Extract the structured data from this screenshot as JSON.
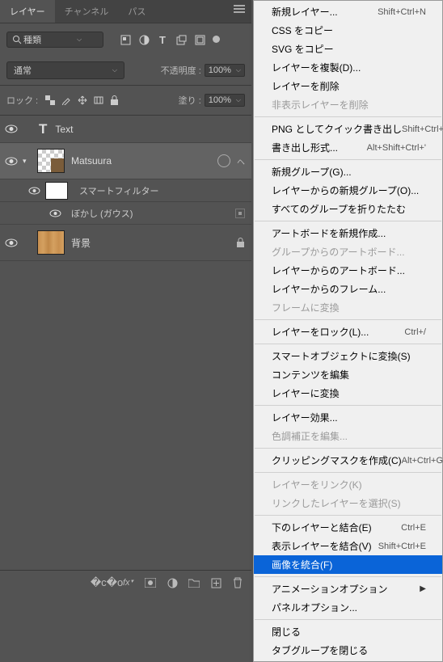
{
  "tabs": [
    "レイヤー",
    "チャンネル",
    "パス"
  ],
  "activeTab": 0,
  "search": {
    "placeholder": "種類"
  },
  "blend": {
    "mode": "通常",
    "opacityLabel": "不透明度 :",
    "opacity": "100%"
  },
  "lock": {
    "label": "ロック :",
    "fillLabel": "塗り :",
    "fill": "100%"
  },
  "layers": [
    {
      "name": "Text",
      "type": "text"
    },
    {
      "name": "Matsuura",
      "type": "smart",
      "selected": true
    },
    {
      "name": "スマートフィルター",
      "type": "sf-head"
    },
    {
      "name": "ぼかし (ガウス)",
      "type": "sf-item"
    },
    {
      "name": "背景",
      "type": "bg"
    }
  ],
  "menu": [
    {
      "t": "item",
      "label": "新規レイヤー...",
      "sc": "Shift+Ctrl+N"
    },
    {
      "t": "item",
      "label": "CSS をコピー"
    },
    {
      "t": "item",
      "label": "SVG をコピー"
    },
    {
      "t": "item",
      "label": "レイヤーを複製(D)..."
    },
    {
      "t": "item",
      "label": "レイヤーを削除"
    },
    {
      "t": "item",
      "label": "非表示レイヤーを削除",
      "dis": true
    },
    {
      "t": "sep"
    },
    {
      "t": "item",
      "label": "PNG としてクイック書き出し",
      "sc": "Shift+Ctrl+'"
    },
    {
      "t": "item",
      "label": "書き出し形式...",
      "sc": "Alt+Shift+Ctrl+'"
    },
    {
      "t": "sep"
    },
    {
      "t": "item",
      "label": "新規グループ(G)..."
    },
    {
      "t": "item",
      "label": "レイヤーからの新規グループ(O)..."
    },
    {
      "t": "item",
      "label": "すべてのグループを折りたたむ"
    },
    {
      "t": "sep"
    },
    {
      "t": "item",
      "label": "アートボードを新規作成..."
    },
    {
      "t": "item",
      "label": "グループからのアートボード...",
      "dis": true
    },
    {
      "t": "item",
      "label": "レイヤーからのアートボード..."
    },
    {
      "t": "item",
      "label": "レイヤーからのフレーム..."
    },
    {
      "t": "item",
      "label": "フレームに変換",
      "dis": true
    },
    {
      "t": "sep"
    },
    {
      "t": "item",
      "label": "レイヤーをロック(L)...",
      "sc": "Ctrl+/"
    },
    {
      "t": "sep"
    },
    {
      "t": "item",
      "label": "スマートオブジェクトに変換(S)"
    },
    {
      "t": "item",
      "label": "コンテンツを編集"
    },
    {
      "t": "item",
      "label": "レイヤーに変換"
    },
    {
      "t": "sep"
    },
    {
      "t": "item",
      "label": "レイヤー効果..."
    },
    {
      "t": "item",
      "label": "色調補正を編集...",
      "dis": true
    },
    {
      "t": "sep"
    },
    {
      "t": "item",
      "label": "クリッピングマスクを作成(C)",
      "sc": "Alt+Ctrl+G"
    },
    {
      "t": "sep"
    },
    {
      "t": "item",
      "label": "レイヤーをリンク(K)",
      "dis": true
    },
    {
      "t": "item",
      "label": "リンクしたレイヤーを選択(S)",
      "dis": true
    },
    {
      "t": "sep"
    },
    {
      "t": "item",
      "label": "下のレイヤーと結合(E)",
      "sc": "Ctrl+E"
    },
    {
      "t": "item",
      "label": "表示レイヤーを結合(V)",
      "sc": "Shift+Ctrl+E"
    },
    {
      "t": "item",
      "label": "画像を統合(F)",
      "hl": true
    },
    {
      "t": "sep"
    },
    {
      "t": "item",
      "label": "アニメーションオプション",
      "sub": true
    },
    {
      "t": "item",
      "label": "パネルオプション..."
    },
    {
      "t": "sep"
    },
    {
      "t": "item",
      "label": "閉じる"
    },
    {
      "t": "item",
      "label": "タブグループを閉じる"
    }
  ]
}
